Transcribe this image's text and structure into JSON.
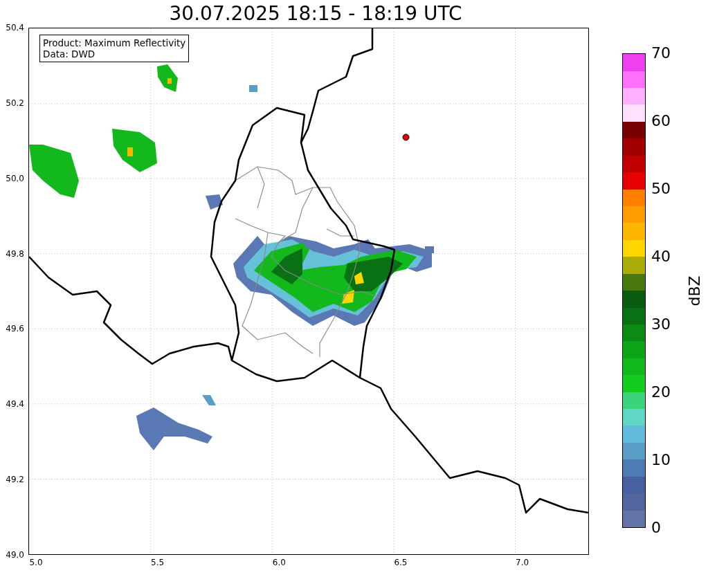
{
  "title": "30.07.2025 18:15 - 18:19 UTC",
  "legend": [
    "Product: Maximum Reflectivity",
    "Data: DWD"
  ],
  "x_ticks": [
    "5.0",
    "5.5",
    "6.0",
    "6.5",
    "7.0"
  ],
  "y_ticks": [
    "50.4",
    "50.2",
    "50.0",
    "49.8",
    "49.6",
    "49.4",
    "49.2",
    "49.0"
  ],
  "colorbar": {
    "label": "dBZ",
    "ticks": [
      "70",
      "60",
      "50",
      "40",
      "30",
      "20",
      "10",
      "0"
    ],
    "bins": [
      {
        "color": "#6274a6"
      },
      {
        "color": "#5466a0"
      },
      {
        "color": "#4860a0"
      },
      {
        "color": "#4d7cb4"
      },
      {
        "color": "#5a9ec8"
      },
      {
        "color": "#62bcdc"
      },
      {
        "color": "#60d6c4"
      },
      {
        "color": "#3cd47a"
      },
      {
        "color": "#12cc20"
      },
      {
        "color": "#10b81c"
      },
      {
        "color": "#0ea418"
      },
      {
        "color": "#0c8a14"
      },
      {
        "color": "#0a7014"
      },
      {
        "color": "#0a5a10"
      },
      {
        "color": "#4a7810"
      },
      {
        "color": "#acac08"
      },
      {
        "color": "#ffd600"
      },
      {
        "color": "#ffb600"
      },
      {
        "color": "#ff9c00"
      },
      {
        "color": "#ff8000"
      },
      {
        "color": "#e80000"
      },
      {
        "color": "#c00000"
      },
      {
        "color": "#a00000"
      },
      {
        "color": "#780000"
      },
      {
        "color": "#ffe0ff"
      },
      {
        "color": "#ffb0ff"
      },
      {
        "color": "#ff70ff"
      },
      {
        "color": "#ee40ee"
      }
    ]
  }
}
